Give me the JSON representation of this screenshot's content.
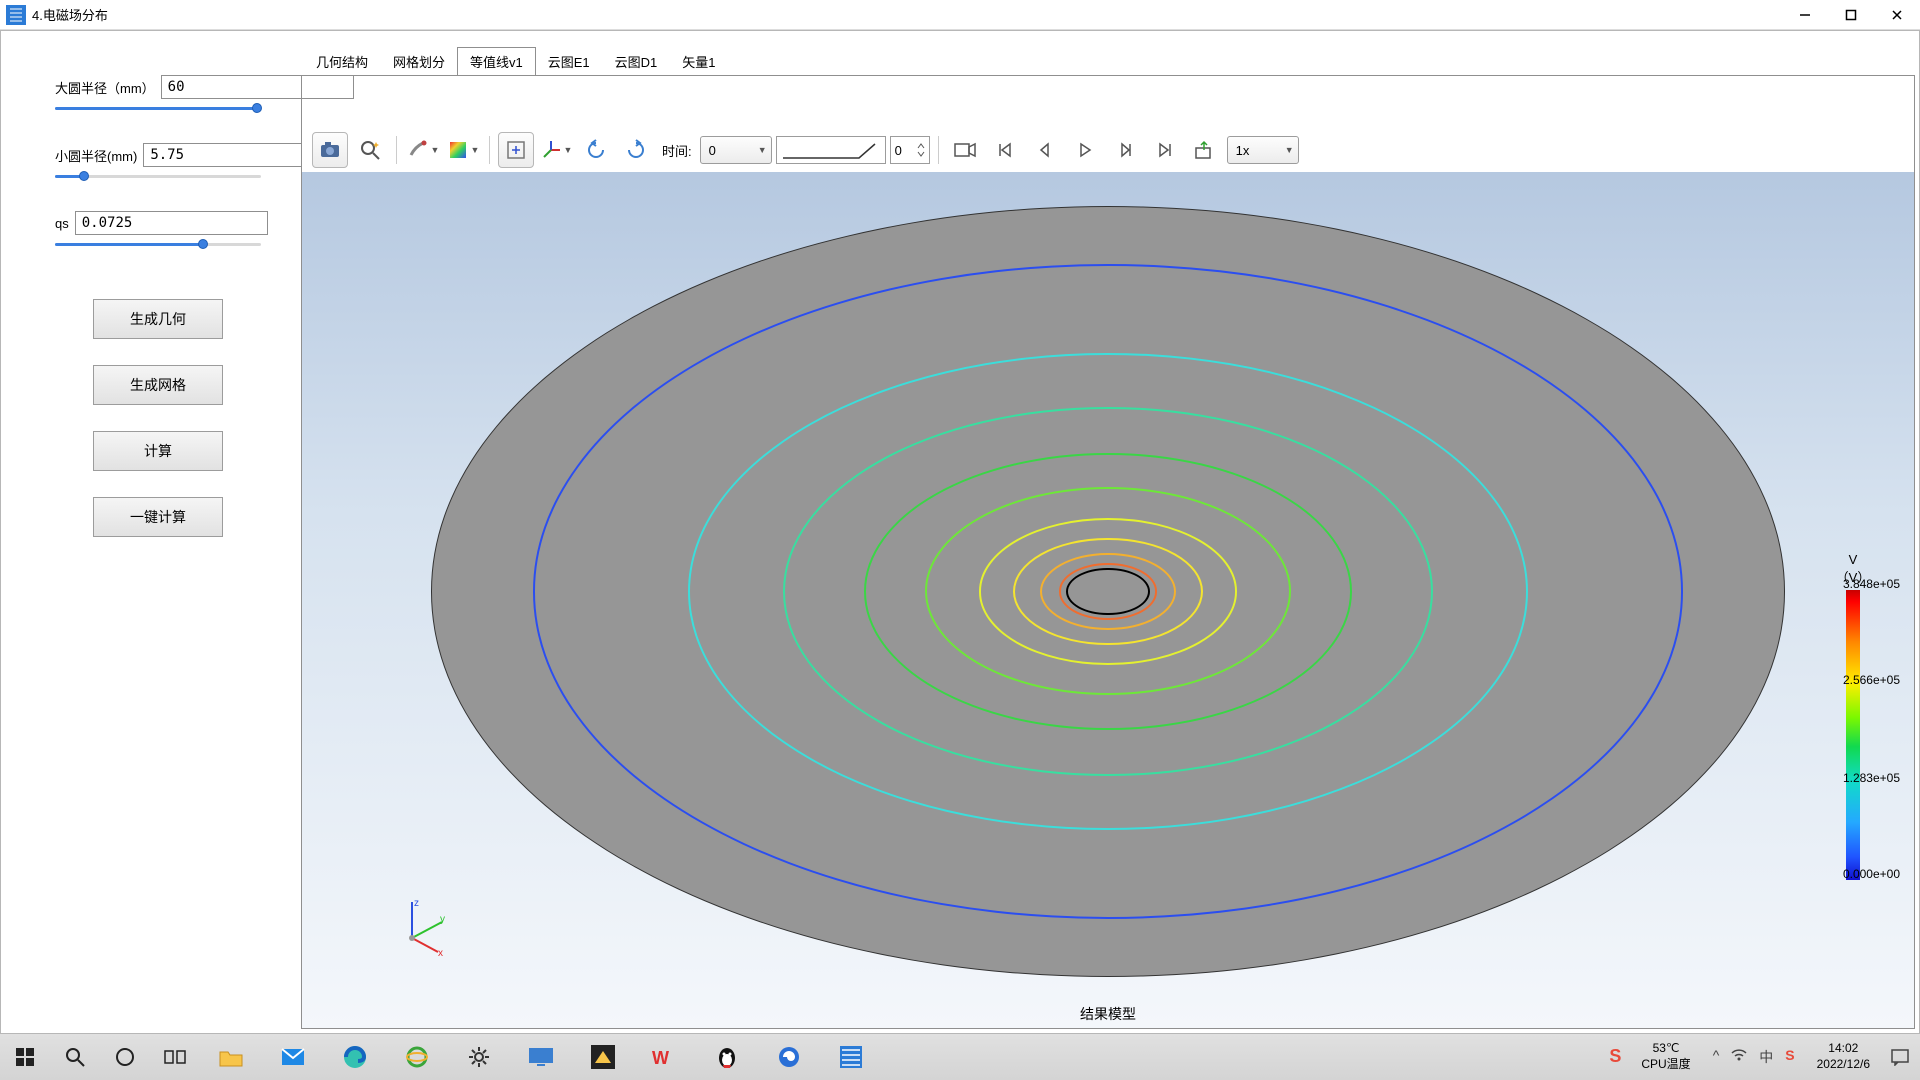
{
  "window": {
    "title": "4.电磁场分布"
  },
  "sidebar": {
    "params": [
      {
        "label": "大圆半径（mm）",
        "value": "60",
        "fill_pct": 98
      },
      {
        "label": "小圆半径(mm)",
        "value": "5.75",
        "fill_pct": 14
      },
      {
        "label": "qs",
        "value": "0.0725",
        "fill_pct": 72
      }
    ],
    "buttons": {
      "gen_geom": "生成几何",
      "gen_mesh": "生成网格",
      "calc": "计算",
      "one_key": "一键计算"
    }
  },
  "tabs": [
    {
      "label": "几何结构"
    },
    {
      "label": "网格划分"
    },
    {
      "label": "等值线v1",
      "active": true
    },
    {
      "label": "云图E1"
    },
    {
      "label": "云图D1"
    },
    {
      "label": "矢量1"
    }
  ],
  "gfx_toolbar": {
    "time_label": "时间:",
    "time_value": "0",
    "frame_value": "0",
    "speed": "1x"
  },
  "canvas": {
    "caption": "结果模型",
    "contours": [
      {
        "w_pct": 85,
        "h_pct": 85,
        "cx_pct": 50,
        "cy_pct": 50,
        "color": "#2b4ef0"
      },
      {
        "w_pct": 62,
        "h_pct": 62,
        "cx_pct": 50,
        "cy_pct": 50,
        "color": "#3bdedb"
      },
      {
        "w_pct": 48,
        "h_pct": 48,
        "cx_pct": 50,
        "cy_pct": 50,
        "color": "#38dfa0"
      },
      {
        "w_pct": 36,
        "h_pct": 36,
        "cx_pct": 50,
        "cy_pct": 50,
        "color": "#3ad646"
      },
      {
        "w_pct": 27,
        "h_pct": 27,
        "cx_pct": 50,
        "cy_pct": 50,
        "color": "#6de838"
      },
      {
        "w_pct": 19,
        "h_pct": 19,
        "cx_pct": 50,
        "cy_pct": 50,
        "color": "#e4f12f"
      },
      {
        "w_pct": 14,
        "h_pct": 14,
        "cx_pct": 50,
        "cy_pct": 50,
        "color": "#f4e42f"
      },
      {
        "w_pct": 10,
        "h_pct": 10,
        "cx_pct": 50,
        "cy_pct": 50,
        "color": "#f3b02f"
      },
      {
        "w_pct": 7.3,
        "h_pct": 7.3,
        "cx_pct": 50,
        "cy_pct": 50,
        "color": "#f06d2f"
      },
      {
        "w_pct": 6.2,
        "h_pct": 6.2,
        "cx_pct": 50,
        "cy_pct": 50,
        "color": "#000000"
      }
    ]
  },
  "legend": {
    "title1": "V",
    "title2": "（V）",
    "ticks": [
      {
        "pos_pct": 0,
        "text": "3.848e+05"
      },
      {
        "pos_pct": 33,
        "text": "2.566e+05"
      },
      {
        "pos_pct": 67,
        "text": "1.283e+05"
      },
      {
        "pos_pct": 100,
        "text": "0.000e+00"
      }
    ]
  },
  "tray": {
    "temp": "53℃",
    "cpu": "CPU温度",
    "time": "14:02",
    "date": "2022/12/6"
  }
}
